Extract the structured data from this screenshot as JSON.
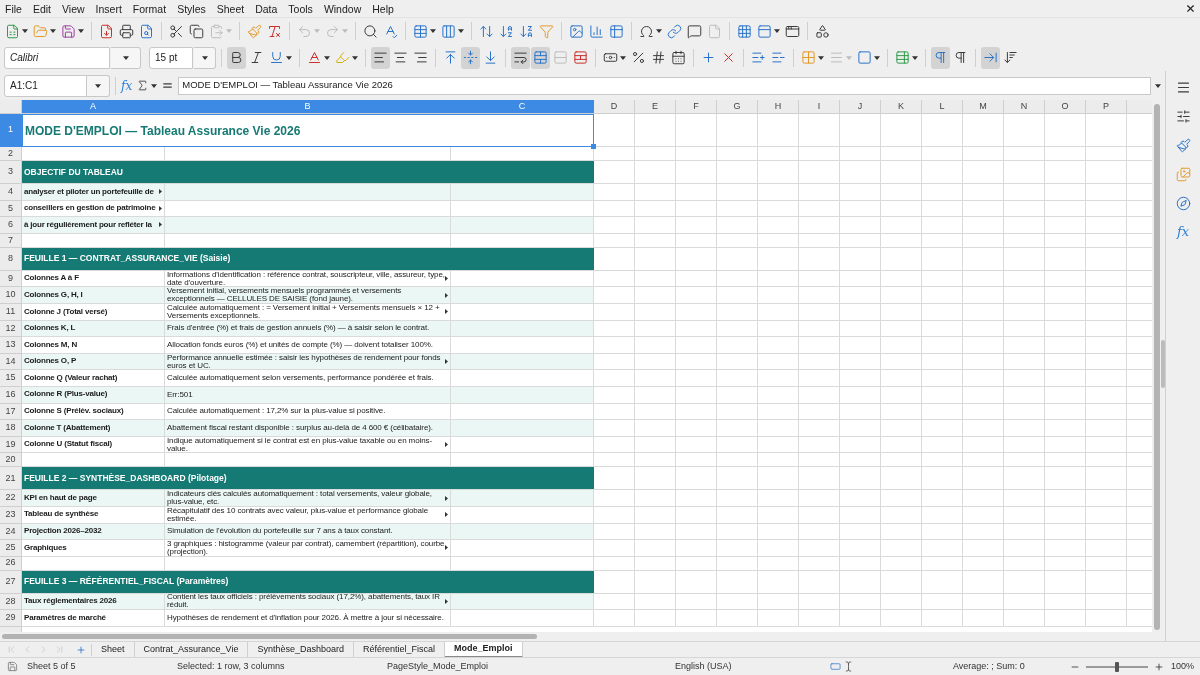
{
  "menu_bar": {
    "items": [
      "File",
      "Edit",
      "View",
      "Insert",
      "Format",
      "Styles",
      "Sheet",
      "Data",
      "Tools",
      "Window",
      "Help"
    ]
  },
  "standard_toolbar": {
    "buttons": [
      {
        "disabled": false
      },
      {
        "disabled": false
      },
      {
        "disabled": false
      },
      {
        "disabled": false
      },
      {
        "disabled": false
      },
      {
        "disabled": false
      },
      {
        "disabled": false
      },
      {
        "disabled": false
      },
      {
        "disabled": true
      },
      {
        "disabled": false
      },
      {
        "disabled": false
      },
      {
        "disabled": true
      },
      {
        "disabled": true
      },
      {
        "disabled": false
      },
      {
        "disabled": false
      },
      {
        "disabled": false
      },
      {
        "disabled": false
      },
      {
        "disabled": false
      },
      {
        "disabled": false
      },
      {
        "disabled": false
      },
      {
        "disabled": false
      },
      {
        "disabled": false
      },
      {
        "disabled": false
      },
      {
        "disabled": false
      },
      {
        "disabled": false
      },
      {
        "disabled": false
      },
      {
        "disabled": false
      },
      {
        "disabled": true
      },
      {
        "disabled": false
      },
      {
        "disabled": false
      },
      {
        "disabled": false
      },
      {
        "disabled": false
      }
    ]
  },
  "formatting_toolbar": {
    "font_name": "Calibri",
    "font_size": "15 pt",
    "buttons": [
      {
        "pressed": true,
        "disabled": false
      },
      {
        "pressed": false,
        "disabled": false
      },
      {
        "pressed": false,
        "disabled": false
      },
      {
        "pressed": false,
        "disabled": false
      },
      {
        "pressed": false,
        "disabled": false
      },
      {
        "pressed": true,
        "disabled": false
      },
      {
        "pressed": false,
        "disabled": false
      },
      {
        "pressed": false,
        "disabled": false
      },
      {
        "pressed": false,
        "disabled": false
      },
      {
        "pressed": true,
        "disabled": false
      },
      {
        "pressed": false,
        "disabled": false
      },
      {
        "pressed": true,
        "disabled": false
      },
      {
        "pressed": true,
        "disabled": false
      },
      {
        "pressed": false,
        "disabled": true
      },
      {
        "pressed": false,
        "disabled": false
      },
      {
        "pressed": false,
        "disabled": false
      },
      {
        "pressed": false,
        "disabled": false
      },
      {
        "pressed": false,
        "disabled": false
      },
      {
        "pressed": false,
        "disabled": false
      },
      {
        "pressed": false,
        "disabled": false
      },
      {
        "pressed": false,
        "disabled": false
      },
      {
        "pressed": false,
        "disabled": false
      },
      {
        "pressed": false,
        "disabled": false
      },
      {
        "pressed": false,
        "disabled": false
      },
      {
        "pressed": false,
        "disabled": true
      },
      {
        "pressed": false,
        "disabled": false
      },
      {
        "pressed": false,
        "disabled": false
      },
      {
        "pressed": true,
        "disabled": false
      },
      {
        "pressed": false,
        "disabled": false
      },
      {
        "pressed": true,
        "disabled": false
      },
      {
        "pressed": false,
        "disabled": false
      }
    ]
  },
  "formula_bar": {
    "name_box": "A1:C1",
    "function_wizard": "fx",
    "content": "MODE D'EMPLOI — Tableau Assurance Vie 2026"
  },
  "sheet": {
    "columns": [
      {
        "label": "A",
        "selected": true
      },
      {
        "label": "B",
        "selected": true
      },
      {
        "label": "C",
        "selected": true
      },
      {
        "label": "D",
        "selected": false
      },
      {
        "label": "E",
        "selected": false
      },
      {
        "label": "F",
        "selected": false
      },
      {
        "label": "G",
        "selected": false
      },
      {
        "label": "H",
        "selected": false
      },
      {
        "label": "I",
        "selected": false
      },
      {
        "label": "J",
        "selected": false
      },
      {
        "label": "K",
        "selected": false
      },
      {
        "label": "L",
        "selected": false
      },
      {
        "label": "M",
        "selected": false
      },
      {
        "label": "N",
        "selected": false
      },
      {
        "label": "O",
        "selected": false
      },
      {
        "label": "P",
        "selected": false
      }
    ],
    "rows": [
      {
        "number": "1",
        "kind": "title",
        "selected": true,
        "text": "MODE D'EMPLOI — Tableau Assurance Vie 2026"
      },
      {
        "number": "2",
        "kind": "blank",
        "selected": false
      },
      {
        "number": "3",
        "kind": "section",
        "selected": false,
        "text": "OBJECTIF DU TABLEAU"
      },
      {
        "number": "4",
        "kind": "entry",
        "selected": false,
        "shaded": true,
        "label": "analyser et piloter un portefeuille de",
        "label_clipped": true,
        "note_clipped": false
      },
      {
        "number": "5",
        "kind": "entry",
        "selected": false,
        "shaded": false,
        "label": "conseillers en gestion de patrimoine",
        "label_clipped": true,
        "note_clipped": false
      },
      {
        "number": "6",
        "kind": "entry",
        "selected": false,
        "shaded": true,
        "label": "à jour régulièrement pour refléter la",
        "label_clipped": true,
        "note_clipped": false
      },
      {
        "number": "7",
        "kind": "blank",
        "selected": false
      },
      {
        "number": "8",
        "kind": "section",
        "selected": false,
        "text": "FEUILLE 1 — CONTRAT_ASSURANCE_VIE (Saisie)"
      },
      {
        "number": "9",
        "kind": "entry",
        "selected": false,
        "shaded": false,
        "label": "Colonnes A à F",
        "note": "Informations d'identification : référence contrat, souscripteur, ville, assureur, type, date d'ouverture.",
        "label_clipped": false,
        "note_clipped": true
      },
      {
        "number": "10",
        "kind": "entry",
        "selected": false,
        "shaded": true,
        "label": "Colonnes G, H, I",
        "note": "Versement initial, versements mensuels programmés et versements exceptionnels — CELLULES DE SAISIE (fond jaune).",
        "label_clipped": false,
        "note_clipped": true
      },
      {
        "number": "11",
        "kind": "entry",
        "selected": false,
        "shaded": false,
        "label": "Colonne J (Total versé)",
        "note": "Calculée automatiquement : = Versement initial + Versements mensuels × 12 + Versements exceptionnels.",
        "label_clipped": false,
        "note_clipped": true
      },
      {
        "number": "12",
        "kind": "entry",
        "selected": false,
        "shaded": true,
        "label": "Colonnes K, L",
        "note": "Frais d'entrée (%) et frais de gestion annuels (%) — à saisir selon le contrat.",
        "label_clipped": false,
        "note_clipped": false
      },
      {
        "number": "13",
        "kind": "entry",
        "selected": false,
        "shaded": false,
        "label": "Colonnes M, N",
        "note": "Allocation fonds euros (%) et unités de compte (%) — doivent totaliser 100%.",
        "label_clipped": false,
        "note_clipped": false
      },
      {
        "number": "14",
        "kind": "entry",
        "selected": false,
        "shaded": true,
        "label": "Colonnes O, P",
        "note": "Performance annuelle estimée : saisir les hypothèses de rendement pour fonds euros et UC.",
        "label_clipped": false,
        "note_clipped": true
      },
      {
        "number": "15",
        "kind": "entry",
        "selected": false,
        "shaded": false,
        "label": "Colonne Q (Valeur rachat)",
        "note": "Calculée automatiquement selon versements, performance pondérée et frais.",
        "label_clipped": false,
        "note_clipped": false
      },
      {
        "number": "16",
        "kind": "entry",
        "selected": false,
        "shaded": true,
        "label": "Colonne R (Plus-value)",
        "note": "Err:501",
        "label_clipped": false,
        "note_clipped": false
      },
      {
        "number": "17",
        "kind": "entry",
        "selected": false,
        "shaded": false,
        "label": "Colonne S (Prélèv. sociaux)",
        "note": "Calculée automatiquement : 17,2% sur la plus-value si positive.",
        "label_clipped": false,
        "note_clipped": false
      },
      {
        "number": "18",
        "kind": "entry",
        "selected": false,
        "shaded": true,
        "label": "Colonne T (Abattement)",
        "note": "Abattement fiscal restant disponible : surplus au-delà de 4 600 € (célibataire).",
        "label_clipped": false,
        "note_clipped": false
      },
      {
        "number": "19",
        "kind": "entry",
        "selected": false,
        "shaded": false,
        "label": "Colonne U (Statut fiscal)",
        "note": "Indique automatiquement si le contrat est en plus-value taxable ou en moins-value.",
        "label_clipped": false,
        "note_clipped": true
      },
      {
        "number": "20",
        "kind": "blank",
        "selected": false
      },
      {
        "number": "21",
        "kind": "section",
        "selected": false,
        "text": "FEUILLE 2 — SYNTHÈSE_DASHBOARD (Pilotage)"
      },
      {
        "number": "22",
        "kind": "entry",
        "selected": false,
        "shaded": true,
        "label": "KPI en haut de page",
        "note": "Indicateurs clés calculés automatiquement : total versements, valeur globale, plus-value, etc.",
        "label_clipped": false,
        "note_clipped": true
      },
      {
        "number": "23",
        "kind": "entry",
        "selected": false,
        "shaded": false,
        "label": "Tableau de synthèse",
        "note": "Récapitulatif des 10 contrats avec valeur, plus-value et performance globale estimée.",
        "label_clipped": false,
        "note_clipped": true
      },
      {
        "number": "24",
        "kind": "entry",
        "selected": false,
        "shaded": true,
        "label": "Projection 2026–2032",
        "note": "Simulation de l'évolution du portefeuille sur 7 ans à taux constant.",
        "label_clipped": false,
        "note_clipped": false
      },
      {
        "number": "25",
        "kind": "entry",
        "selected": false,
        "shaded": false,
        "label": "Graphiques",
        "note": "3 graphiques : histogramme (valeur par contrat), camembert (répartition), courbe (projection).",
        "label_clipped": false,
        "note_clipped": true
      },
      {
        "number": "26",
        "kind": "blank",
        "selected": false
      },
      {
        "number": "27",
        "kind": "section",
        "selected": false,
        "text": "FEUILLE 3 — RÉFÉRENTIEL_FISCAL (Paramètres)"
      },
      {
        "number": "28",
        "kind": "entry",
        "selected": false,
        "shaded": true,
        "label": "Taux réglementaires 2026",
        "note": "Contient les taux officiels : prélèvements sociaux (17,2%), abattements, taux IR réduit.",
        "label_clipped": false,
        "note_clipped": true
      },
      {
        "number": "29",
        "kind": "entry",
        "selected": false,
        "shaded": false,
        "label": "Paramètres de marché",
        "note": "Hypothèses de rendement et d'inflation pour 2026. À mettre à jour si nécessaire.",
        "label_clipped": false,
        "note_clipped": false
      }
    ]
  },
  "sidebar": {
    "functions_label": "fx"
  },
  "sheet_tabs": {
    "navigation": [
      {
        "disabled": true
      },
      {
        "disabled": true
      },
      {
        "disabled": true
      },
      {
        "disabled": true
      }
    ],
    "tabs": [
      {
        "label": "Sheet",
        "selected": false
      },
      {
        "label": "Contrat_Assurance_Vie",
        "selected": false
      },
      {
        "label": "Synthèse_Dashboard",
        "selected": false
      },
      {
        "label": "Référentiel_Fiscal",
        "selected": false
      },
      {
        "label": "Mode_Emploi",
        "selected": true
      }
    ]
  },
  "status_bar": {
    "sheet_position": "Sheet 5 of 5",
    "selection": "Selected: 1 row, 3 columns",
    "page_style": "PageStyle_Mode_Emploi",
    "language": "English (USA)",
    "statistics": "Average: ; Sum: 0",
    "zoom": {
      "level": 0.5,
      "reading": "100%"
    }
  }
}
